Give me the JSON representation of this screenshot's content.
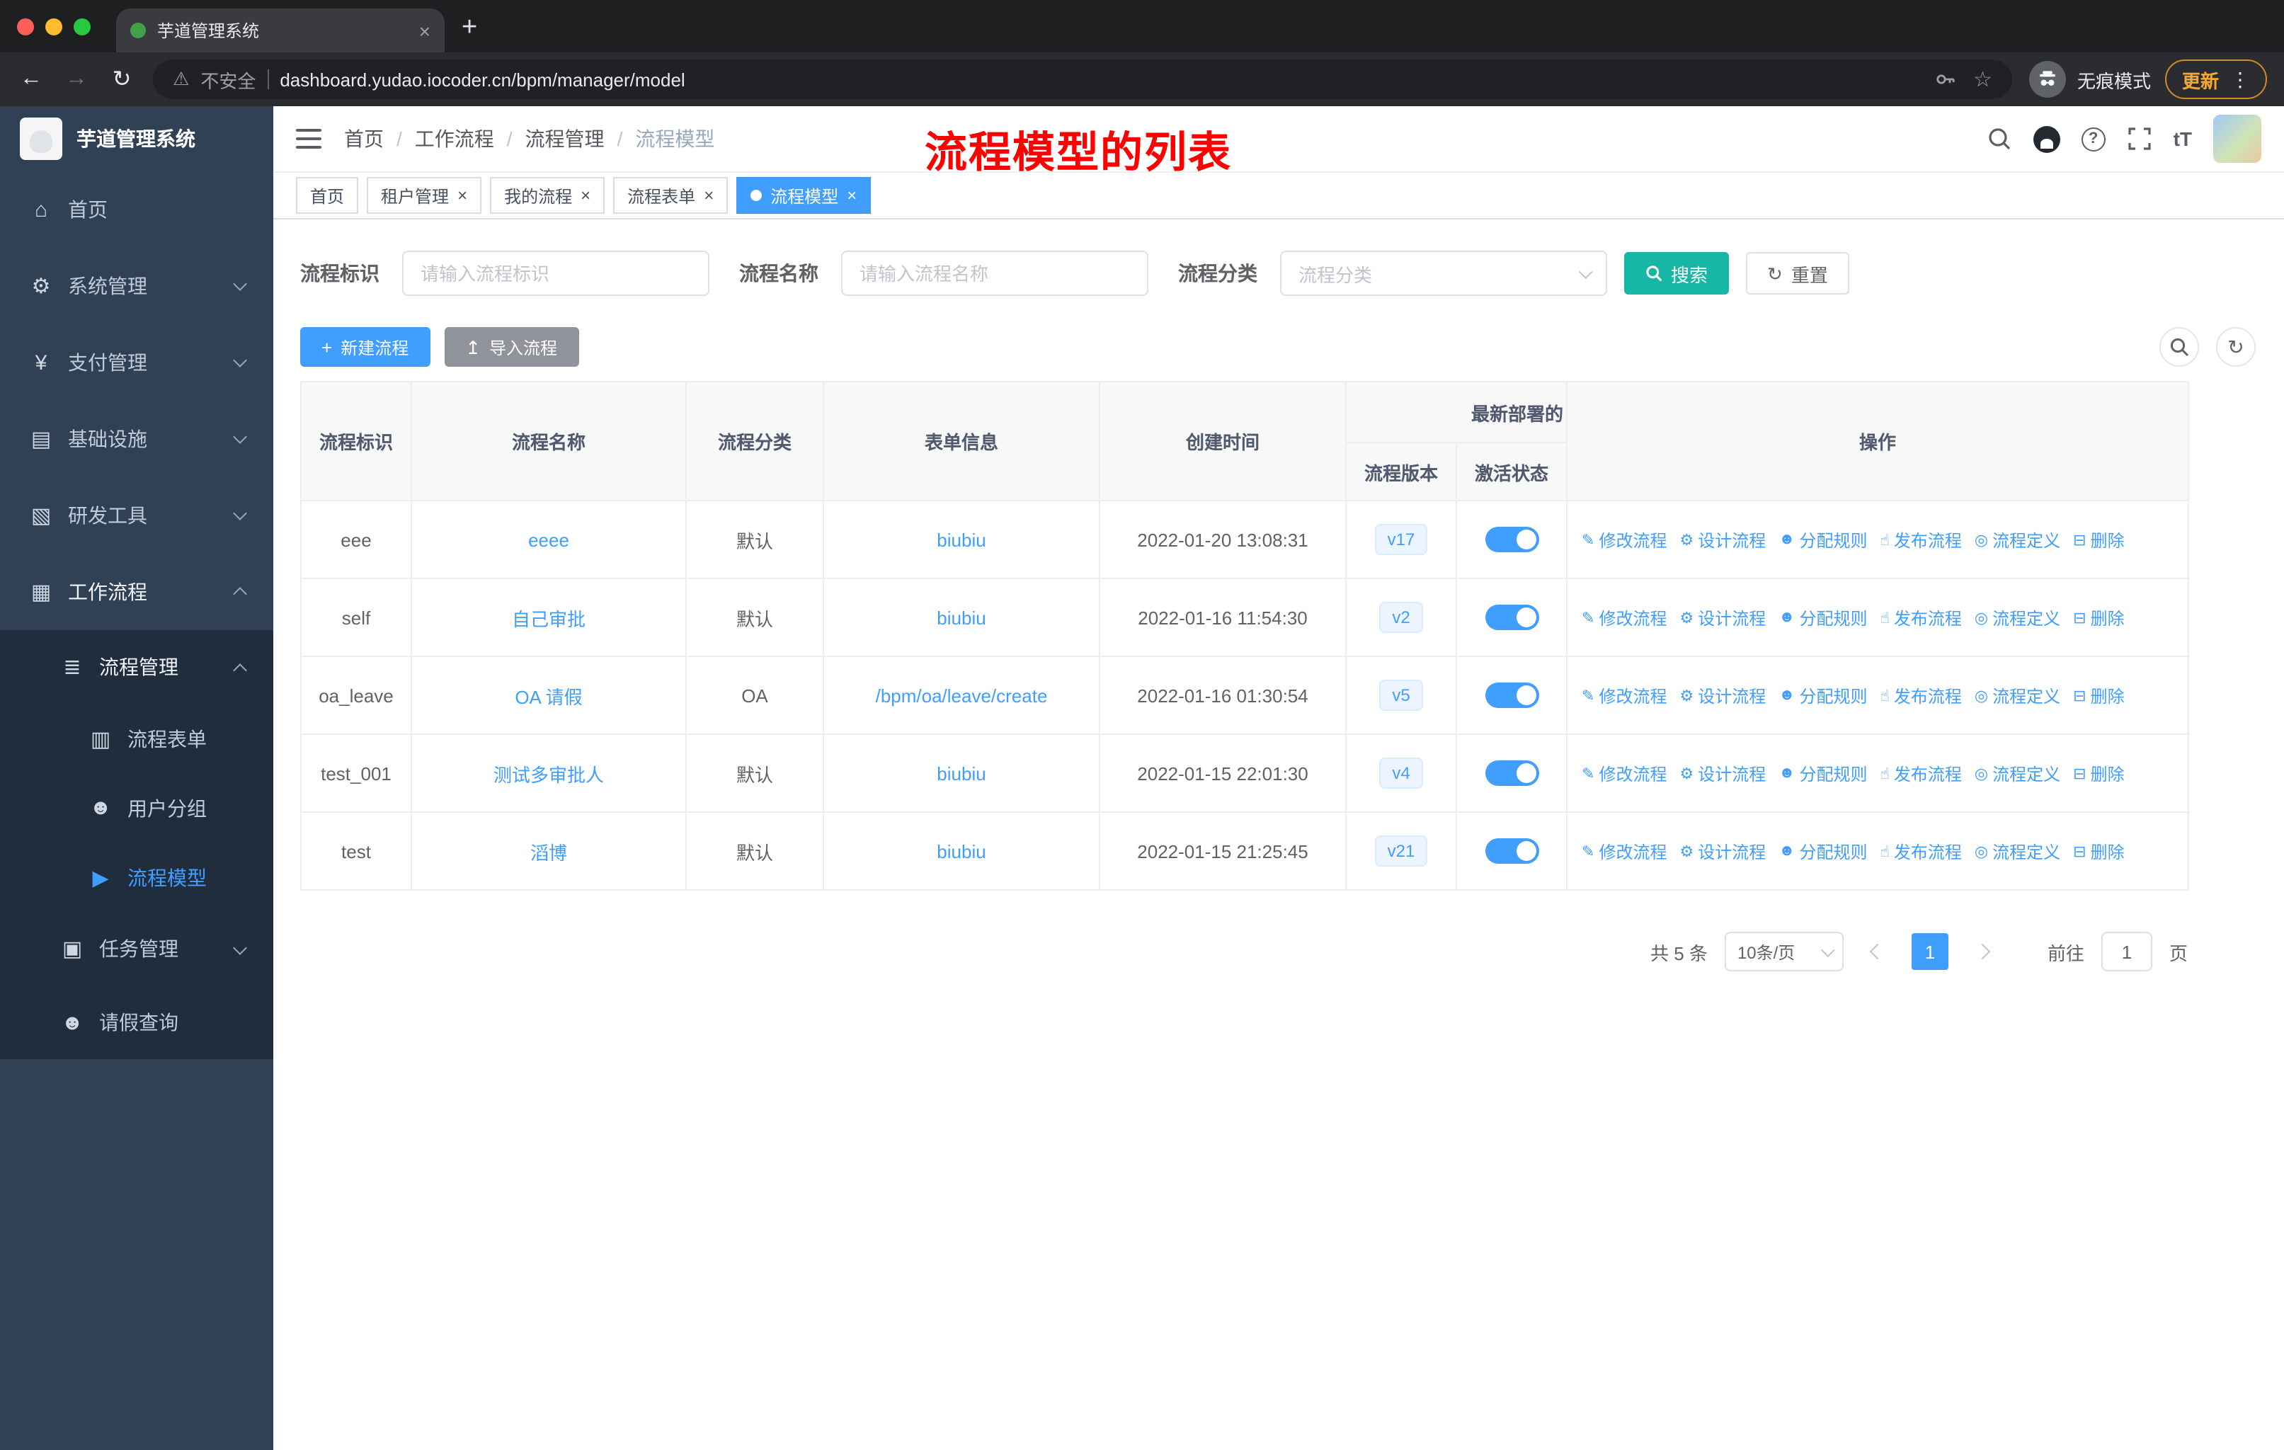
{
  "browser": {
    "tab_title": "芋道管理系统",
    "security_label": "不安全",
    "url": "dashboard.yudao.iocoder.cn/bpm/manager/model",
    "incognito_label": "无痕模式",
    "update_label": "更新"
  },
  "sidebar": {
    "logo_title": "芋道管理系统",
    "items": [
      {
        "id": "home",
        "label": "首页",
        "icon": "home-icon",
        "glyph": "⌂",
        "level": 1
      },
      {
        "id": "system",
        "label": "系统管理",
        "icon": "gear-icon",
        "glyph": "⚙",
        "level": 1,
        "chevron": "down"
      },
      {
        "id": "payment",
        "label": "支付管理",
        "icon": "yen-icon",
        "glyph": "¥",
        "level": 1,
        "chevron": "down"
      },
      {
        "id": "infrastructure",
        "label": "基础设施",
        "icon": "monitor-icon",
        "glyph": "▤",
        "level": 1,
        "chevron": "down"
      },
      {
        "id": "dev-tools",
        "label": "研发工具",
        "icon": "tools-icon",
        "glyph": "▧",
        "level": 1,
        "chevron": "down"
      },
      {
        "id": "workflow",
        "label": "工作流程",
        "icon": "workflow-icon",
        "glyph": "▦",
        "level": 1,
        "chevron": "up",
        "open": true
      },
      {
        "id": "process-manage",
        "label": "流程管理",
        "icon": "list-icon",
        "glyph": "≣",
        "level": 2,
        "chevron": "up",
        "open": true
      },
      {
        "id": "process-form",
        "label": "流程表单",
        "icon": "form-icon",
        "glyph": "▥",
        "level": 3
      },
      {
        "id": "user-group",
        "label": "用户分组",
        "icon": "users-icon",
        "glyph": "☻",
        "level": 3
      },
      {
        "id": "process-model",
        "label": "流程模型",
        "icon": "paper-plane-icon",
        "glyph": "▶",
        "level": 3,
        "active": true
      },
      {
        "id": "task-manage",
        "label": "任务管理",
        "icon": "task-icon",
        "glyph": "▣",
        "level": 2,
        "chevron": "down"
      },
      {
        "id": "leave-query",
        "label": "请假查询",
        "icon": "user-icon",
        "glyph": "☻",
        "level": 2
      }
    ]
  },
  "navbar": {
    "breadcrumb": [
      "首页",
      "工作流程",
      "流程管理",
      "流程模型"
    ],
    "annotation": "流程模型的列表"
  },
  "tags": [
    {
      "label": "首页",
      "closable": false,
      "active": false
    },
    {
      "label": "租户管理",
      "closable": true,
      "active": false
    },
    {
      "label": "我的流程",
      "closable": true,
      "active": false
    },
    {
      "label": "流程表单",
      "closable": true,
      "active": false
    },
    {
      "label": "流程模型",
      "closable": true,
      "active": true
    }
  ],
  "filters": {
    "key_label": "流程标识",
    "key_placeholder": "请输入流程标识",
    "name_label": "流程名称",
    "name_placeholder": "请输入流程名称",
    "category_label": "流程分类",
    "category_placeholder": "流程分类",
    "search_label": "搜索",
    "reset_label": "重置"
  },
  "toolbar": {
    "create_label": "新建流程",
    "import_label": "导入流程"
  },
  "table": {
    "headers": {
      "key": "流程标识",
      "name": "流程名称",
      "category": "流程分类",
      "form": "表单信息",
      "create_time": "创建时间",
      "deploy_group": "最新部署的",
      "version": "流程版本",
      "active": "激活状态",
      "actions": "操作"
    },
    "actions": [
      {
        "label": "修改流程",
        "glyph": "✎",
        "icon": "edit-icon"
      },
      {
        "label": "设计流程",
        "glyph": "⚙",
        "icon": "design-icon"
      },
      {
        "label": "分配规则",
        "glyph": "☻",
        "icon": "assign-rule-icon"
      },
      {
        "label": "发布流程",
        "glyph": "☝",
        "icon": "publish-icon"
      },
      {
        "label": "流程定义",
        "glyph": "◎",
        "icon": "definition-icon"
      },
      {
        "label": "删除",
        "glyph": "⊟",
        "icon": "delete-icon"
      }
    ],
    "rows": [
      {
        "key": "eee",
        "name": "eeee",
        "category": "默认",
        "form": "biubiu",
        "created": "2022-01-20 13:08:31",
        "version": "v17",
        "active": true
      },
      {
        "key": "self",
        "name": "自己审批",
        "category": "默认",
        "form": "biubiu",
        "created": "2022-01-16 11:54:30",
        "version": "v2",
        "active": true
      },
      {
        "key": "oa_leave",
        "name": "OA 请假",
        "category": "OA",
        "form": "/bpm/oa/leave/create",
        "created": "2022-01-16 01:30:54",
        "version": "v5",
        "active": true
      },
      {
        "key": "test_001",
        "name": "测试多审批人",
        "category": "默认",
        "form": "biubiu",
        "created": "2022-01-15 22:01:30",
        "version": "v4",
        "active": true
      },
      {
        "key": "test",
        "name": "滔博",
        "category": "默认",
        "form": "biubiu",
        "created": "2022-01-15 21:25:45",
        "version": "v21",
        "active": true
      }
    ]
  },
  "pagination": {
    "total_label": "共 5 条",
    "page_size": "10条/页",
    "current_page": "1",
    "goto_label": "前往",
    "goto_value": "1",
    "page_unit": "页"
  },
  "colors": {
    "primary": "#409eff",
    "search_button": "#18b7a5",
    "annotation_red": "#fe0000",
    "sidebar_bg": "#304156",
    "submenu_bg": "#1f2d3d",
    "active_tag": "#409eff"
  }
}
